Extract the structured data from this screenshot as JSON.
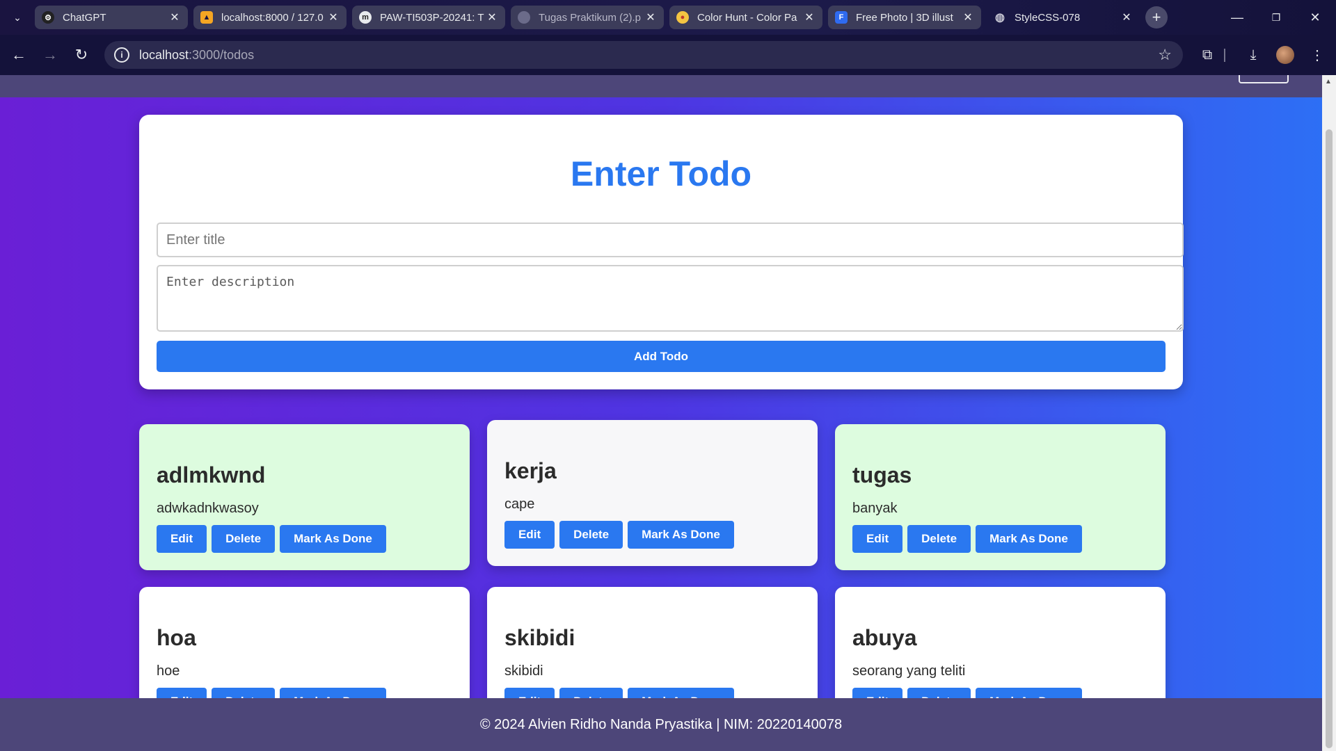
{
  "browser": {
    "tabs": [
      {
        "title": "ChatGPT",
        "icon": "chatgpt-favicon"
      },
      {
        "title": "localhost:8000 / 127.0",
        "icon": "phpmyadmin-favicon"
      },
      {
        "title": "PAW-TI503P-20241: T",
        "icon": "moodle-favicon"
      },
      {
        "title": "Tugas Praktikum (2).p",
        "icon": "pdf-favicon"
      },
      {
        "title": "Color Hunt - Color Pa",
        "icon": "colorhunt-favicon"
      },
      {
        "title": "Free Photo | 3D illust",
        "icon": "freepik-favicon"
      },
      {
        "title": "StyleCSS-078",
        "icon": "globe-favicon",
        "active": true
      }
    ],
    "address": {
      "host": "localhost",
      "path": ":3000/todos"
    }
  },
  "form": {
    "heading": "Enter Todo",
    "title_placeholder": "Enter title",
    "description_placeholder": "Enter description",
    "add_label": "Add Todo"
  },
  "todo_buttons": {
    "edit": "Edit",
    "delete": "Delete",
    "done": "Mark As Done"
  },
  "todos": [
    {
      "title": "adlmkwnd",
      "description": "adwkadnkwasoy"
    },
    {
      "title": "kerja",
      "description": "cape"
    },
    {
      "title": "tugas",
      "description": "banyak"
    },
    {
      "title": "hoa",
      "description": "hoe"
    },
    {
      "title": "skibidi",
      "description": "skibidi"
    },
    {
      "title": "abuya",
      "description": "seorang yang teliti"
    }
  ],
  "footer": {
    "text": "© 2024 Alvien Ridho Nanda Pryastika | NIM: 20220140078"
  },
  "colors": {
    "accent": "#2a78f0",
    "done_card": "#ddfcdf",
    "footer": "#4d4679"
  }
}
